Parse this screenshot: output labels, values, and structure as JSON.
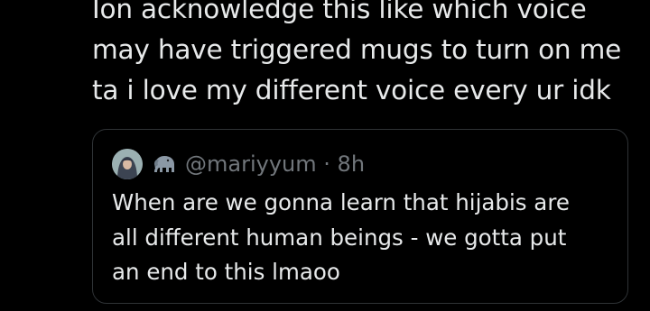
{
  "tweet": {
    "text_lines": [
      "Ion acknowledge this like which voice",
      "may have triggered mugs to turn on me",
      "ta i love my different voice every ur idk"
    ]
  },
  "quote": {
    "handle": "@mariyyum",
    "separator": "·",
    "time": "8h",
    "avatar_icon": "user-avatar",
    "badge_icon": "elephant-icon",
    "text_lines": [
      "When are we gonna learn that hijabis are",
      "all different human beings - we gotta put",
      "an end to this lmaoo"
    ]
  },
  "colors": {
    "background": "#000000",
    "text_primary": "#e7e9ea",
    "text_secondary": "#71767b",
    "border": "#2f3336"
  }
}
